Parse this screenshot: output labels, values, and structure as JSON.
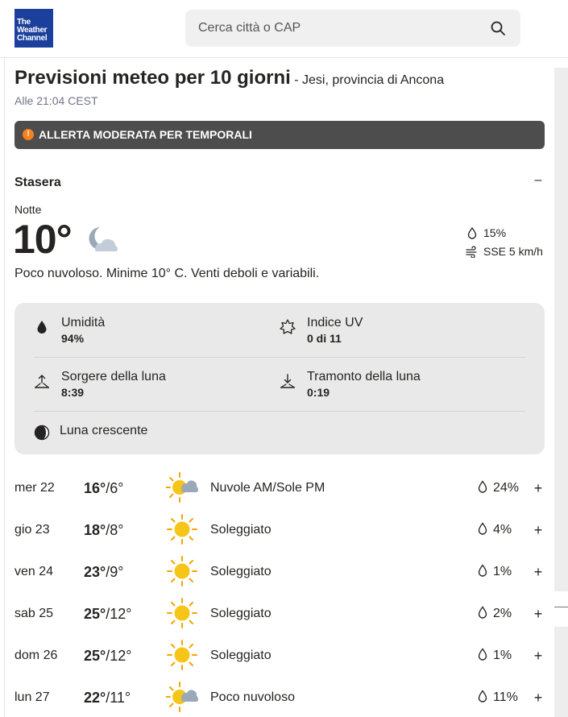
{
  "header": {
    "logo_lines": [
      "The",
      "Weather",
      "Channel"
    ],
    "search_placeholder": "Cerca città o CAP"
  },
  "page": {
    "title": "Previsioni meteo per 10 giorni",
    "location": " - Jesi, provincia di Ancona",
    "timestamp": "Alle 21:04 CEST"
  },
  "alert": {
    "text": "ALLERTA MODERATA PER TEMPORALI",
    "icon": "exclamation-icon",
    "color": "#f5821f"
  },
  "tonight": {
    "section_title": "Stasera",
    "collapse_symbol": "–",
    "period": "Notte",
    "temperature": "10°",
    "icon": "moon-cloud-icon",
    "precip": "15%",
    "wind": "SSE 5 km/h",
    "narrative": "Poco nuvoloso. Minime 10° C. Venti deboli e variabili."
  },
  "details": {
    "humidity_label": "Umidità",
    "humidity_value": "94%",
    "uv_label": "Indice UV",
    "uv_value": "0 di 11",
    "moonrise_label": "Sorgere della luna",
    "moonrise_value": "8:39",
    "moonset_label": "Tramonto della luna",
    "moonset_value": "0:19",
    "moon_phase": "Luna crescente"
  },
  "days": [
    {
      "date": "mer 22",
      "hi": "16°",
      "lo": "/6°",
      "icon": "sun-cloud-icon",
      "condition": "Nuvole AM/Sole PM",
      "precip": "24%"
    },
    {
      "date": "gio 23",
      "hi": "18°",
      "lo": "/8°",
      "icon": "sun-icon",
      "condition": "Soleggiato",
      "precip": "4%"
    },
    {
      "date": "ven 24",
      "hi": "23°",
      "lo": "/9°",
      "icon": "sun-icon",
      "condition": "Soleggiato",
      "precip": "1%"
    },
    {
      "date": "sab 25",
      "hi": "25°",
      "lo": "/12°",
      "icon": "sun-icon",
      "condition": "Soleggiato",
      "precip": "2%"
    },
    {
      "date": "dom 26",
      "hi": "25°",
      "lo": "/12°",
      "icon": "sun-icon",
      "condition": "Soleggiato",
      "precip": "1%"
    },
    {
      "date": "lun 27",
      "hi": "22°",
      "lo": "/11°",
      "icon": "sun-cloud-icon",
      "condition": "Poco nuvoloso",
      "precip": "11%"
    }
  ],
  "expand_symbol": "+",
  "colors": {
    "brand": "#1b3f9c",
    "alert_bg": "#4d4d4d",
    "sun": "#f5c518",
    "sun_rays": "#f5a500",
    "cloud": "#9aa9b8"
  }
}
